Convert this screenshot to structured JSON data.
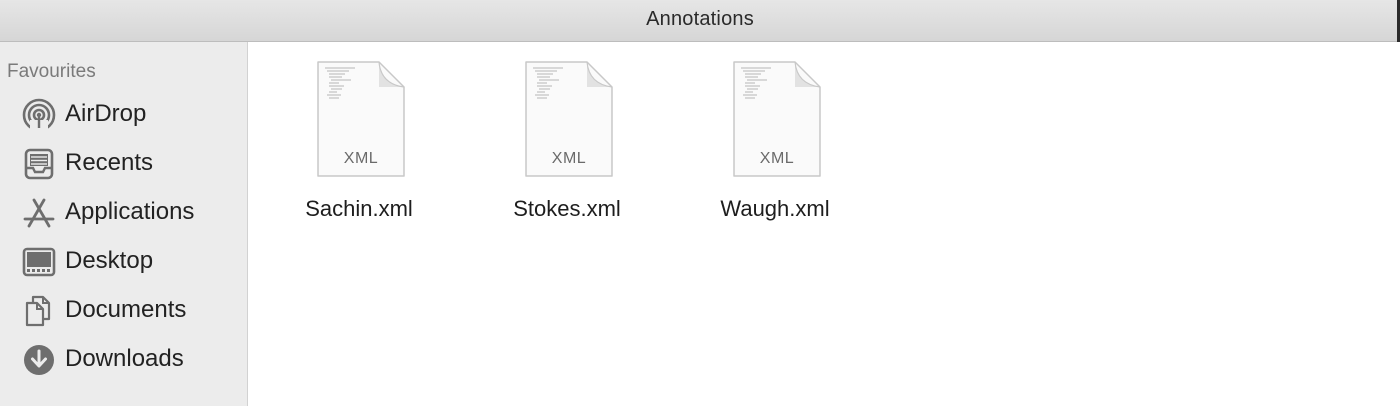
{
  "window": {
    "title": "Annotations"
  },
  "sidebar": {
    "section_title": "Favourites",
    "items": [
      {
        "label": "AirDrop",
        "icon": "airdrop-icon"
      },
      {
        "label": "Recents",
        "icon": "recents-icon"
      },
      {
        "label": "Applications",
        "icon": "applications-icon"
      },
      {
        "label": "Desktop",
        "icon": "desktop-icon"
      },
      {
        "label": "Documents",
        "icon": "documents-icon"
      },
      {
        "label": "Downloads",
        "icon": "downloads-icon"
      }
    ]
  },
  "files": [
    {
      "name": "Sachin.xml",
      "ext": "XML",
      "icon": "xml-document-icon"
    },
    {
      "name": "Stokes.xml",
      "ext": "XML",
      "icon": "xml-document-icon"
    },
    {
      "name": "Waugh.xml",
      "ext": "XML",
      "icon": "xml-document-icon"
    }
  ],
  "colors": {
    "sidebar_background": "#ececec",
    "icon_gray": "#6e6e6e",
    "titlebar_background": "#dcdcdc"
  }
}
